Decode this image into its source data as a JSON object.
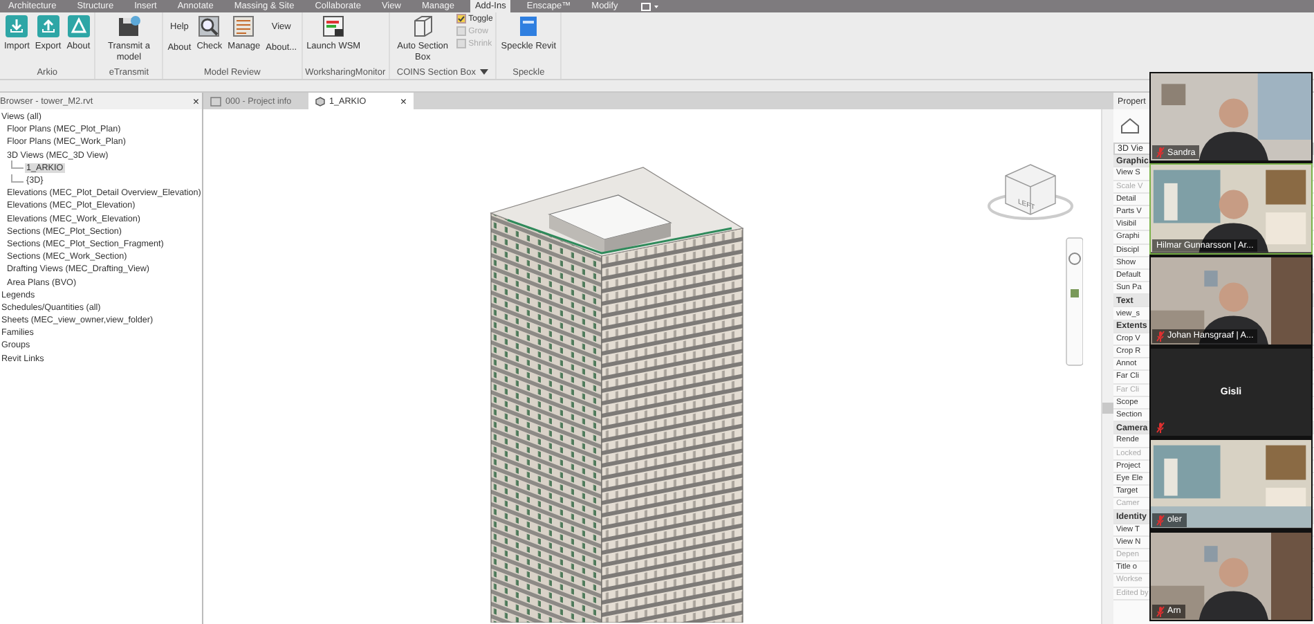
{
  "ribbon": {
    "tabs": [
      {
        "label": "Architecture",
        "selected": false
      },
      {
        "label": "Structure",
        "selected": false
      },
      {
        "label": "Insert",
        "selected": false
      },
      {
        "label": "Annotate",
        "selected": false
      },
      {
        "label": "Massing & Site",
        "selected": false
      },
      {
        "label": "Collaborate",
        "selected": false
      },
      {
        "label": "View",
        "selected": false
      },
      {
        "label": "Manage",
        "selected": false
      },
      {
        "label": "Add-Ins",
        "selected": true
      },
      {
        "label": "Enscape™",
        "selected": false
      },
      {
        "label": "Modify",
        "selected": false
      }
    ],
    "groups": [
      {
        "name": "Arkio",
        "dropdown": false,
        "buttons": [
          {
            "kind": "large",
            "label": "Import"
          },
          {
            "kind": "large",
            "label": "Export"
          },
          {
            "kind": "large",
            "label": "About"
          }
        ]
      },
      {
        "name": "eTransmit",
        "dropdown": false,
        "buttons": [
          {
            "kind": "large",
            "label": "Transmit a model"
          }
        ]
      },
      {
        "name": "Model Review",
        "dropdown": false,
        "buttons": [
          {
            "kind": "stack",
            "labels": [
              "Help",
              "About"
            ]
          },
          {
            "kind": "large",
            "label": "Check"
          },
          {
            "kind": "large",
            "label": "Manage"
          },
          {
            "kind": "stack",
            "labels": [
              "View",
              "About..."
            ]
          }
        ]
      },
      {
        "name": "WorksharingMonitor",
        "dropdown": false,
        "buttons": [
          {
            "kind": "large",
            "label": "Launch WSM"
          }
        ]
      },
      {
        "name": "COINS Section Box",
        "dropdown": true,
        "buttons": [
          {
            "kind": "large",
            "label": "Auto Section Box"
          },
          {
            "kind": "small",
            "label": "Toggle",
            "disabled": false
          },
          {
            "kind": "small",
            "label": "Grow",
            "disabled": true
          },
          {
            "kind": "small",
            "label": "Shrink",
            "disabled": true
          }
        ]
      },
      {
        "name": "Speckle",
        "dropdown": false,
        "buttons": [
          {
            "kind": "large",
            "label": "Speckle Revit"
          }
        ]
      }
    ]
  },
  "browser": {
    "title": "Browser - tower_M2.rvt",
    "close": "×",
    "items": [
      {
        "label": "Views (all)",
        "selected": false,
        "children": [
          {
            "label": "Floor Plans (MEC_Plot_Plan)",
            "selected": false
          },
          {
            "label": "Floor Plans (MEC_Work_Plan)",
            "selected": false
          },
          {
            "label": "3D Views (MEC_3D View)",
            "selected": false,
            "children": [
              {
                "label": "1_ARKIO",
                "selected": true
              },
              {
                "label": "{3D}",
                "selected": false
              }
            ]
          },
          {
            "label": "Elevations (MEC_Plot_Detail Overview_Elevation)",
            "selected": false
          },
          {
            "label": "Elevations (MEC_Plot_Elevation)",
            "selected": false
          },
          {
            "label": "Elevations (MEC_Work_Elevation)",
            "selected": false
          },
          {
            "label": "Sections (MEC_Plot_Section)",
            "selected": false
          },
          {
            "label": "Sections (MEC_Plot_Section_Fragment)",
            "selected": false
          },
          {
            "label": "Sections (MEC_Work_Section)",
            "selected": false
          },
          {
            "label": "Drafting Views (MEC_Drafting_View)",
            "selected": false
          },
          {
            "label": "Area Plans (BVO)",
            "selected": false
          }
        ]
      },
      {
        "label": "Legends",
        "selected": false
      },
      {
        "label": "Schedules/Quantities (all)",
        "selected": false
      },
      {
        "label": "Sheets (MEC_view_owner,view_folder)",
        "selected": false
      },
      {
        "label": "Families",
        "selected": false
      },
      {
        "label": "Groups",
        "selected": false
      },
      {
        "label": "Revit Links",
        "selected": false
      }
    ]
  },
  "view_tabs": [
    {
      "label": "000 - Project info",
      "selected": false
    },
    {
      "label": "1_ARKIO",
      "selected": true,
      "close": "×"
    }
  ],
  "viewcube": {
    "label": "LEFT"
  },
  "properties": {
    "title": "Propert",
    "type": "3D Vie",
    "rows": [
      {
        "kind": "header",
        "label": "Graphic"
      },
      {
        "kind": "row",
        "label": "View S",
        "disabled": false
      },
      {
        "kind": "row",
        "label": "Scale V",
        "disabled": true
      },
      {
        "kind": "row",
        "label": "Detail",
        "disabled": false
      },
      {
        "kind": "row",
        "label": "Parts V",
        "disabled": false
      },
      {
        "kind": "row",
        "label": "Visibil",
        "disabled": false
      },
      {
        "kind": "row",
        "label": "Graphi",
        "disabled": false
      },
      {
        "kind": "row",
        "label": "Discipl",
        "disabled": false
      },
      {
        "kind": "row",
        "label": "Show",
        "disabled": false
      },
      {
        "kind": "row",
        "label": "Default",
        "disabled": false
      },
      {
        "kind": "row",
        "label": "Sun Pa",
        "disabled": false
      },
      {
        "kind": "header",
        "label": "Text"
      },
      {
        "kind": "row",
        "label": "view_s",
        "disabled": false
      },
      {
        "kind": "header",
        "label": "Extents"
      },
      {
        "kind": "row",
        "label": "Crop V",
        "disabled": false
      },
      {
        "kind": "row",
        "label": "Crop R",
        "disabled": false
      },
      {
        "kind": "row",
        "label": "Annot",
        "disabled": false
      },
      {
        "kind": "row",
        "label": "Far Cli",
        "disabled": false
      },
      {
        "kind": "row",
        "label": "Far Cli",
        "disabled": true
      },
      {
        "kind": "row",
        "label": "Scope",
        "disabled": false
      },
      {
        "kind": "row",
        "label": "Section",
        "disabled": false
      },
      {
        "kind": "header",
        "label": "Camera"
      },
      {
        "kind": "row",
        "label": "Rende",
        "disabled": false
      },
      {
        "kind": "row",
        "label": "Locked",
        "disabled": true
      },
      {
        "kind": "row",
        "label": "Project",
        "disabled": false
      },
      {
        "kind": "row",
        "label": "Eye Ele",
        "disabled": false
      },
      {
        "kind": "row",
        "label": "Target",
        "disabled": false
      },
      {
        "kind": "row",
        "label": "Camer",
        "disabled": true
      },
      {
        "kind": "header",
        "label": "Identity"
      },
      {
        "kind": "row",
        "label": "View T",
        "disabled": false
      },
      {
        "kind": "row",
        "label": "View N",
        "disabled": false
      },
      {
        "kind": "row",
        "label": "Depen",
        "disabled": true
      },
      {
        "kind": "row",
        "label": "Title o",
        "disabled": false
      },
      {
        "kind": "row",
        "label": "Workse",
        "disabled": true
      },
      {
        "kind": "row",
        "label": "Edited by",
        "disabled": true
      }
    ]
  },
  "call": {
    "participants": [
      {
        "name": "Sandra",
        "kind": "camera",
        "muted": true,
        "speaking": false
      },
      {
        "name": "Hilmar Gunnarsson | Ar...",
        "kind": "camera",
        "muted": false,
        "speaking": true
      },
      {
        "name": "Johan Hansgraaf | A...",
        "kind": "camera",
        "muted": true,
        "speaking": false
      },
      {
        "name": "Gisli",
        "kind": "avatar",
        "muted": true,
        "speaking": false
      },
      {
        "name": "oler",
        "kind": "camera",
        "muted": true,
        "speaking": false
      },
      {
        "name": "Arn",
        "kind": "camera",
        "muted": true,
        "speaking": false
      }
    ]
  }
}
